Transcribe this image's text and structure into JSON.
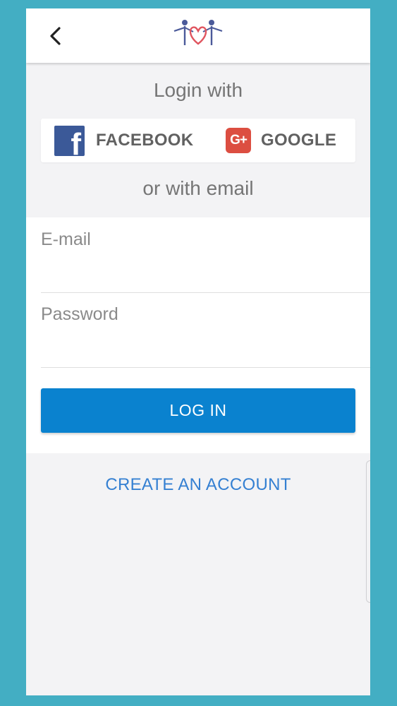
{
  "header": {
    "back_icon": "chevron-left-icon",
    "logo_icon": "family-heart-logo-icon"
  },
  "social": {
    "heading": "Login with",
    "facebook": {
      "icon": "facebook-icon",
      "label": "FACEBOOK",
      "icon_glyph": "f",
      "color": "#3b5998"
    },
    "google": {
      "icon": "google-plus-icon",
      "label": "GOOGLE",
      "icon_glyph": "G+",
      "color": "#dc4e41"
    }
  },
  "email_section": {
    "heading": "or with email"
  },
  "form": {
    "email_placeholder": "E-mail",
    "email_value": "",
    "password_placeholder": "Password",
    "password_value": "",
    "login_label": "LOG IN",
    "login_color": "#0a82cf"
  },
  "create_account": {
    "label": "CREATE AN ACCOUNT",
    "color": "#3580d2"
  },
  "colors": {
    "page_background": "#43aec3",
    "screen_background": "#f3f3f5",
    "heart": "#e0555f",
    "figure": "#4b5a9a"
  }
}
